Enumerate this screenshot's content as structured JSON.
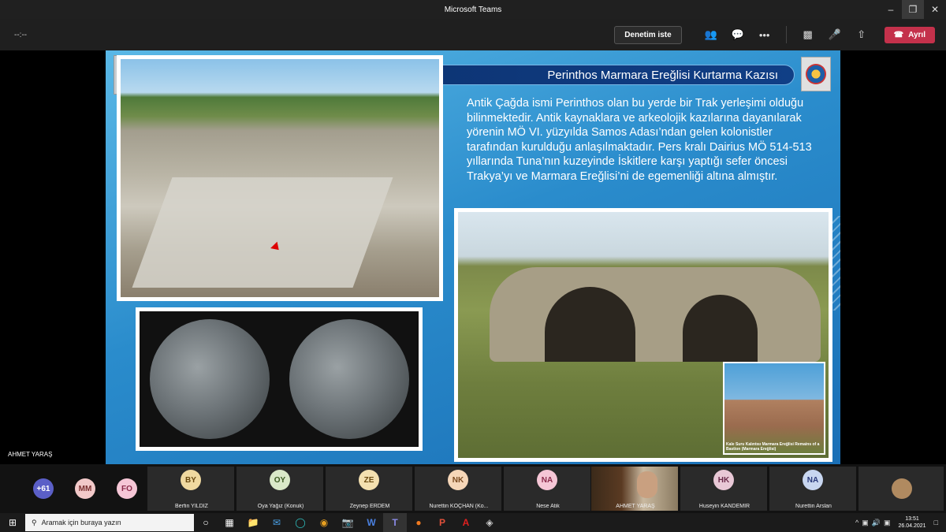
{
  "window": {
    "title": "Microsoft Teams"
  },
  "toolbar": {
    "timer": "--:--",
    "request_control": "Denetim iste",
    "leave": "Ayrıl"
  },
  "presenter": {
    "name": "AHMET YARAŞ"
  },
  "slide": {
    "title": "Perinthos Marmara Ereğlisi Kurtarma Kazısı",
    "body": "Antik Çağda ismi Perinthos olan bu yerde bir Trak yerleşimi olduğu bilinmektedir. Antik kaynaklara ve arkeolojik kazılarına dayanılarak yörenin MÖ VI. yüzyılda Samos Adası’ndan gelen kolonistler tarafından kurulduğu anlaşılmaktadır. Pers kralı Dairius MÖ 514-513 yıllarında Tuna’nın kuzeyinde İskitlere karşı yaptığı sefer öncesi Trakya’yı ve Marmara Ereğlisi’ni de egemenliği altına almıştır.",
    "inset_caption": "Kale Suru Kalıntısı Marmara Ereğlisi Remains of a Bastion (Marmara Ereğlisi)"
  },
  "participants": {
    "overflow": "+61",
    "avatars": [
      {
        "initials": "MM",
        "color": "#f2c9c9",
        "text": "#7a3030"
      },
      {
        "initials": "FO",
        "color": "#f5c6d6",
        "text": "#8a2a4a"
      }
    ],
    "tiles": [
      {
        "initials": "BY",
        "name": "Berfin YILDIZ",
        "color": "#f0d9a0",
        "text": "#6a4a10"
      },
      {
        "initials": "OY",
        "name": "Oya Yağız (Konuk)",
        "color": "#d9e8c8",
        "text": "#3a5a20"
      },
      {
        "initials": "ZE",
        "name": "Zeynep ERDEM",
        "color": "#f3e0b0",
        "text": "#6a4a10"
      },
      {
        "initials": "NK",
        "name": "Nurettin KOÇHAN (Ko...",
        "color": "#f5d6b8",
        "text": "#7a4a20"
      },
      {
        "initials": "NA",
        "name": "Nese Atik",
        "color": "#f5c6d6",
        "text": "#8a2a4a"
      },
      {
        "initials": "HK",
        "name": "Huseyin KANDEMIR",
        "color": "#e8c8d6",
        "text": "#6a2a4a"
      },
      {
        "initials": "NA",
        "name": "Nurettin Arslan",
        "color": "#c8d6f0",
        "text": "#2a3a7a"
      }
    ],
    "video_name": "AHMET YARAŞ"
  },
  "taskbar": {
    "search_placeholder": "Aramak için buraya yazın",
    "time": "13:51",
    "date": "26.04.2021"
  },
  "icons": [
    "teams-icon",
    "search-icon",
    "task-view-icon",
    "file-explorer-icon",
    "mail-icon",
    "edge-icon",
    "chrome-icon",
    "camera-icon",
    "word-icon",
    "teams-icon",
    "firefox-icon",
    "powerpoint-icon",
    "acrobat-icon",
    "photos-icon"
  ]
}
